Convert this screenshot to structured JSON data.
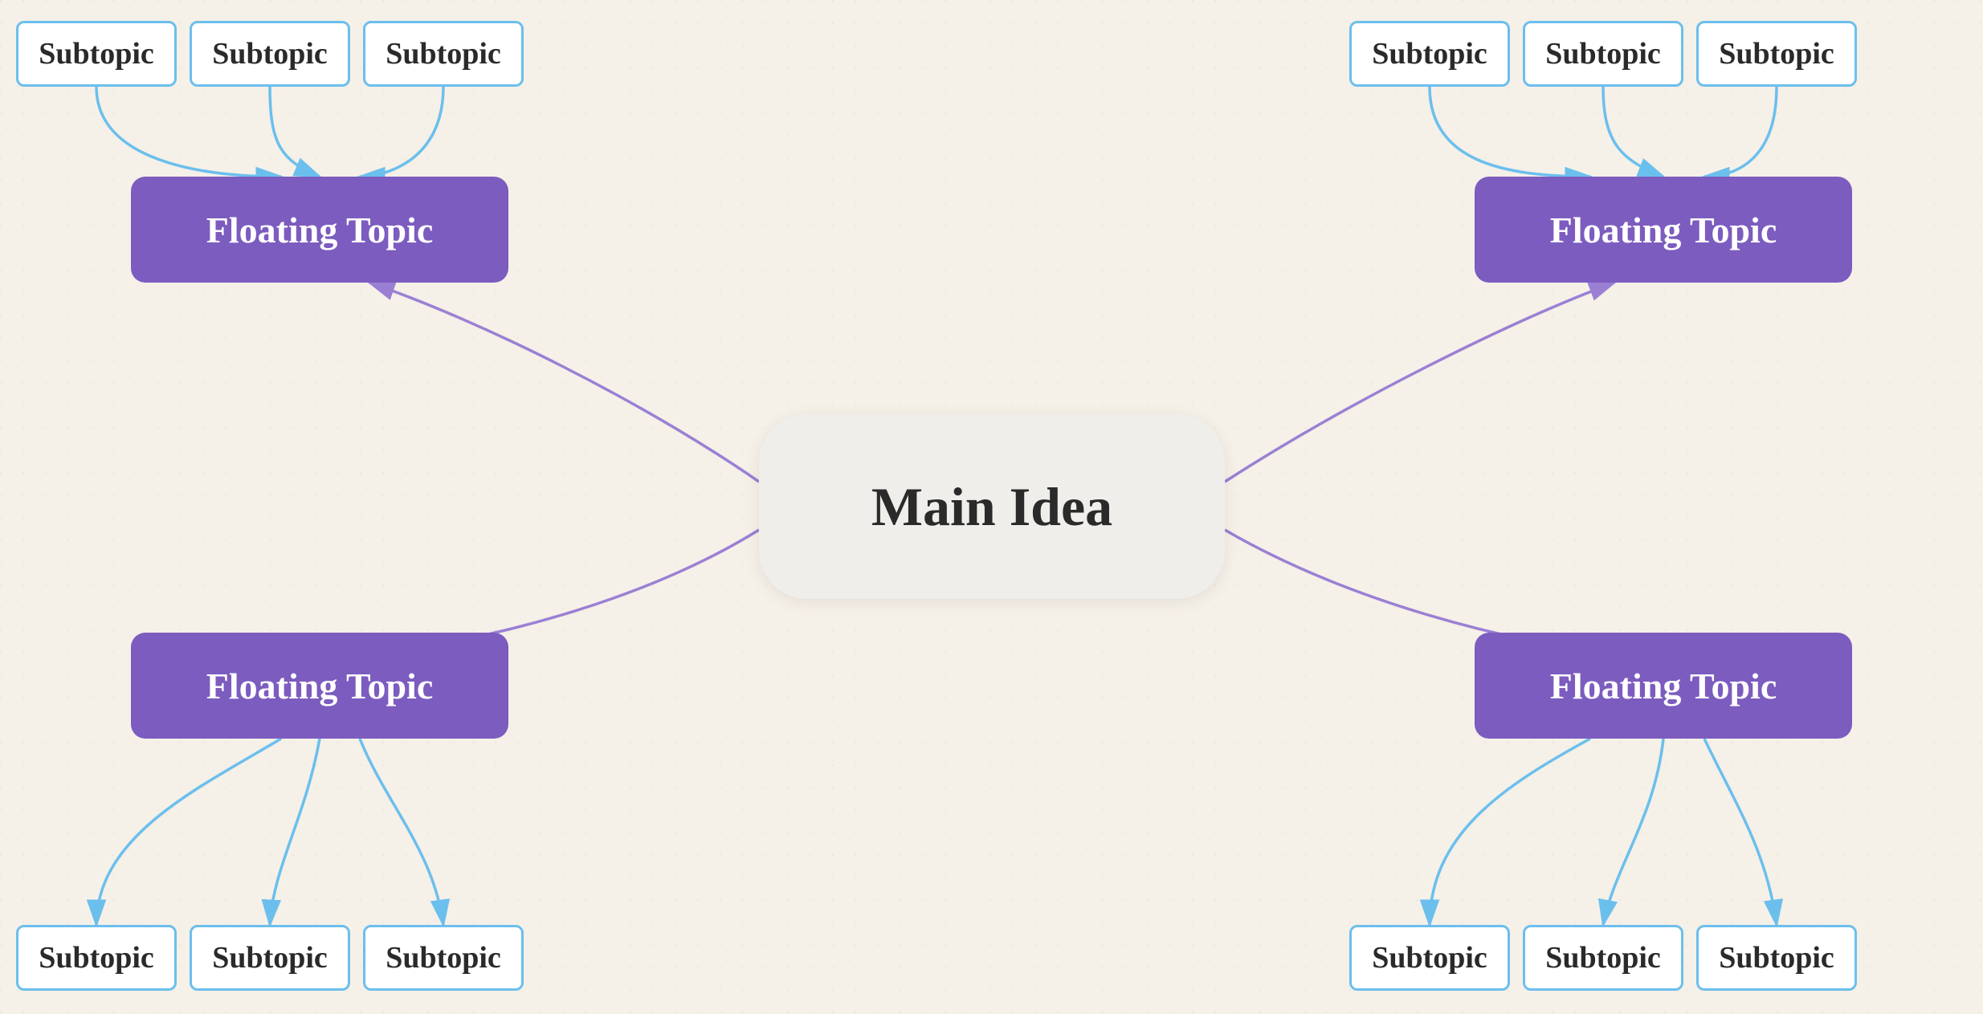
{
  "main_idea": {
    "label": "Main Idea"
  },
  "floating_topics": {
    "top_left": "Floating Topic",
    "top_right": "Floating Topic",
    "bottom_left": "Floating Topic",
    "bottom_right": "Floating Topic"
  },
  "subtopics": {
    "label": "Subtopic"
  },
  "colors": {
    "purple": "#7c5cbf",
    "blue_arrow": "#6bbfed",
    "purple_arrow": "#9b7fd4",
    "main_bg": "#f0eeea"
  }
}
